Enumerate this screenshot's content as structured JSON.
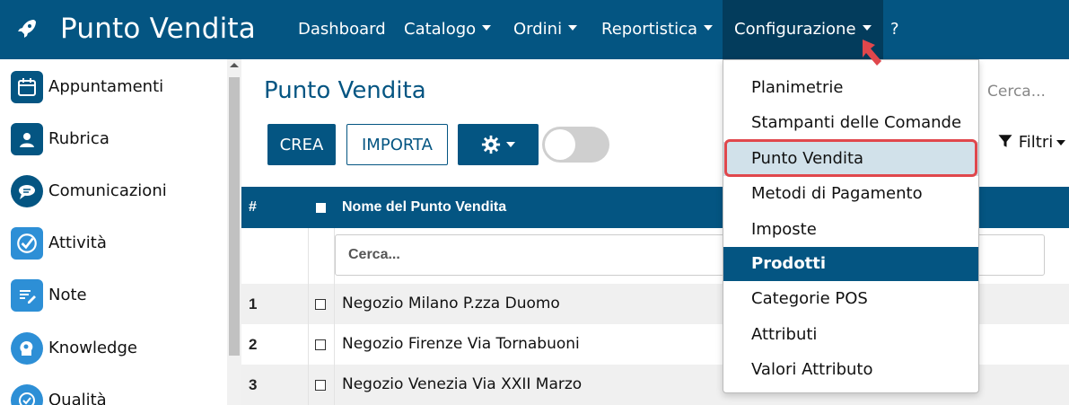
{
  "header": {
    "brand_title": "Punto Vendita",
    "brand_icon": "rocket-icon",
    "nav": [
      "Dashboard",
      "Catalogo",
      "Ordini",
      "Reportistica",
      "Configurazione",
      "?"
    ],
    "colors": {
      "primary": "#045582",
      "active": "#033c5c",
      "highlight": "#e0474c"
    }
  },
  "sidebar": {
    "items": [
      {
        "label": "Appuntamenti",
        "icon": "calendar-icon"
      },
      {
        "label": "Rubrica",
        "icon": "contacts-icon"
      },
      {
        "label": "Comunicazioni",
        "icon": "chat-icon"
      },
      {
        "label": "Attività",
        "icon": "checkmark-icon"
      },
      {
        "label": "Note",
        "icon": "note-icon"
      },
      {
        "label": "Knowledge",
        "icon": "brain-icon"
      },
      {
        "label": "Qualità",
        "icon": "quality-icon"
      }
    ]
  },
  "main": {
    "title": "Punto Vendita",
    "buttons": {
      "create": "CREA",
      "import": "IMPORTA"
    },
    "search_placeholder": "Cerca...",
    "filters_label": "Filtri"
  },
  "table": {
    "headers": {
      "num": "#",
      "name": "Nome del Punto Vendita"
    },
    "filter_placeholder": "Cerca...",
    "rows": [
      {
        "num": "1",
        "name": "Negozio Milano P.zza Duomo"
      },
      {
        "num": "2",
        "name": "Negozio Firenze Via Tornabuoni"
      },
      {
        "num": "3",
        "name": "Negozio Venezia Via XXII Marzo"
      }
    ]
  },
  "dropdown": {
    "items": [
      "Planimetrie",
      "Stampanti delle Comande",
      "Punto Vendita",
      "Metodi di Pagamento",
      "Imposte",
      "Prodotti",
      "Categorie POS",
      "Attributi",
      "Valori Attributo"
    ],
    "highlighted": "Punto Vendita",
    "active": "Prodotti"
  }
}
